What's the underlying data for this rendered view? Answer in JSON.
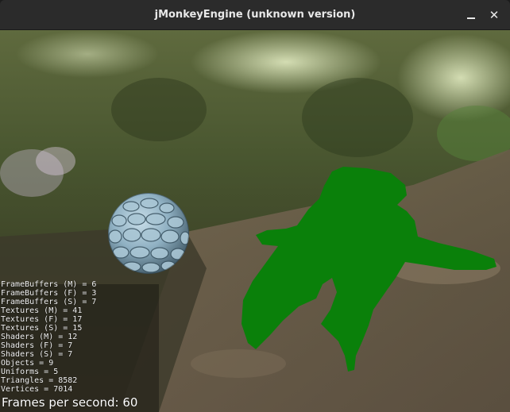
{
  "window": {
    "title": "jMonkeyEngine (unknown version)",
    "minimize_icon": "minimize-icon",
    "close_icon": "close-icon",
    "close_glyph": "✕"
  },
  "scene": {
    "sky_backdrop": "forest-path-skybox",
    "sphere_texture": "blue-pebble-stones",
    "model_color": "#0a800a",
    "model_name": "green-unshaded-model"
  },
  "stats": {
    "lines": [
      "FrameBuffers (M) = 6",
      "FrameBuffers (F) = 3",
      "FrameBuffers (S) = 7",
      "Textures (M) = 41",
      "Textures (F) = 17",
      "Textures (S) = 15",
      "Shaders (M) = 12",
      "Shaders (F) = 7",
      "Shaders (S) = 7",
      "Objects = 9",
      "Uniforms = 5",
      "Triangles = 8582",
      "Vertices = 7014"
    ],
    "fps_text": "Frames per second: 60"
  }
}
